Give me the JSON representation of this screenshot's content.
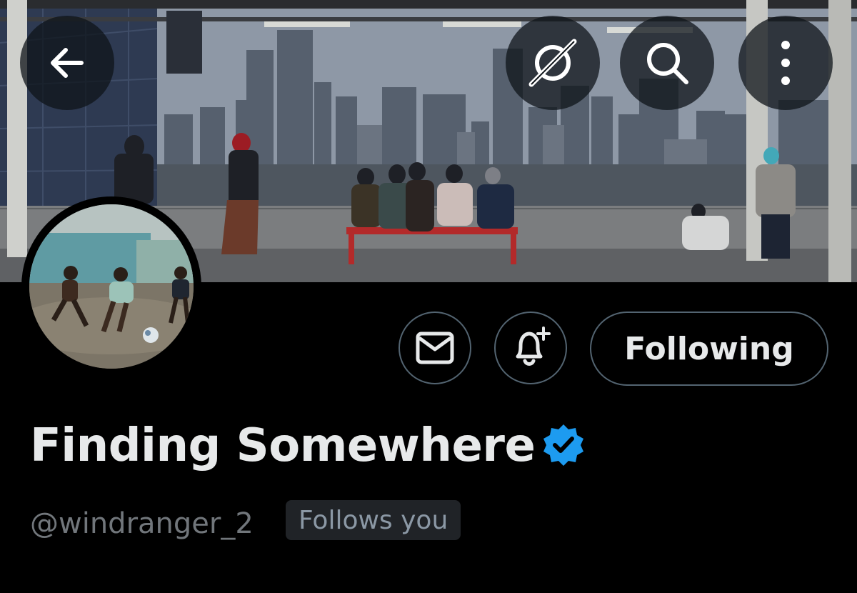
{
  "profile": {
    "display_name": "Finding Somewhere",
    "handle": "@windranger_2",
    "follows_you_label": "Follows you",
    "verified": true,
    "verified_color": "#1d9bf0"
  },
  "header": {
    "back_icon": "arrow-left-icon",
    "grok_icon": "grok-icon",
    "search_icon": "search-icon",
    "more_icon": "more-vertical-icon"
  },
  "actions": {
    "message_icon": "envelope-icon",
    "notify_icon": "bell-plus-icon",
    "following_label": "Following"
  },
  "colors": {
    "background": "#000000",
    "text_primary": "#e7e9ea",
    "text_secondary": "#71767b",
    "border": "#536471",
    "badge_bg": "#202327"
  }
}
